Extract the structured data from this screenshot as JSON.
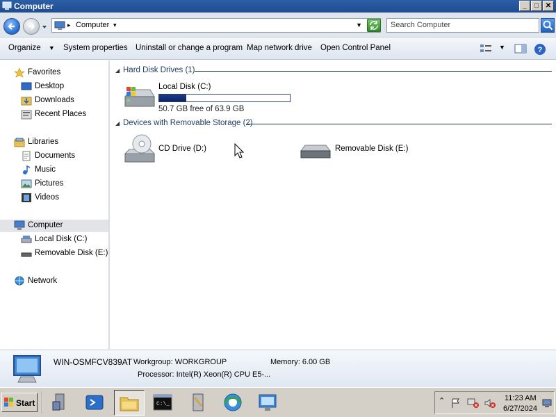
{
  "window": {
    "title": "Computer",
    "buttons": {
      "minimize": "_",
      "maximize": "□",
      "close": "✕"
    }
  },
  "address": {
    "crumb": "Computer",
    "search_placeholder": "Search Computer"
  },
  "toolbar": {
    "organize": "Organize",
    "system_properties": "System properties",
    "uninstall": "Uninstall or change a program",
    "map_drive": "Map network drive",
    "control_panel": "Open Control Panel"
  },
  "nav": {
    "favorites": "Favorites",
    "desktop": "Desktop",
    "downloads": "Downloads",
    "recent_places": "Recent Places",
    "libraries": "Libraries",
    "documents": "Documents",
    "music": "Music",
    "pictures": "Pictures",
    "videos": "Videos",
    "computer": "Computer",
    "local_disk": "Local Disk (C:)",
    "removable_disk": "Removable Disk (E:)",
    "network": "Network"
  },
  "content": {
    "hard_disk_group": "Hard Disk Drives (1)",
    "removable_group": "Devices with Removable Storage (2)",
    "local_disk": {
      "name": "Local Disk (C:)",
      "free_text": "50.7 GB free of 63.9 GB",
      "used_fraction": 0.207
    },
    "cd_drive": "CD Drive (D:)",
    "removable_disk": "Removable Disk (E:)"
  },
  "details": {
    "computer_name": "WIN-OSMFCV839AT",
    "workgroup": "Workgroup: WORKGROUP",
    "memory": "Memory: 6.00 GB",
    "processor": "Processor: Intel(R) Xeon(R) CPU E5-..."
  },
  "taskbar": {
    "start": "Start",
    "time": "11:23 AM",
    "date": "6/27/2024"
  },
  "colors": {
    "capacity_fill": "#12307a",
    "title_bar": "#2457a0",
    "selected_nav": "#e2e4e8"
  }
}
